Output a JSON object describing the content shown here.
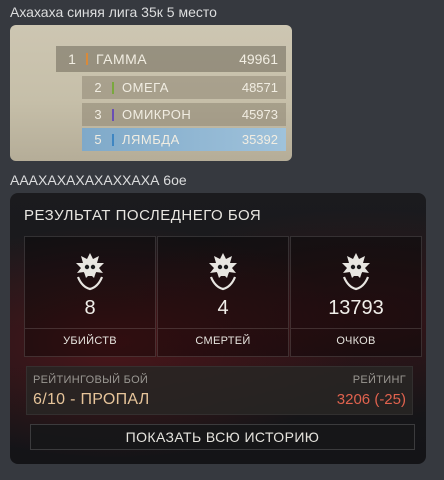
{
  "message1": {
    "text": "Ахахаха синяя лига 35к 5 место"
  },
  "leaderboard": {
    "top": {
      "rank": "1",
      "team": "ГАММА",
      "score": "49961",
      "color": "#d98a3a"
    },
    "rows": [
      {
        "rank": "2",
        "team": "ОМЕГА",
        "score": "48571",
        "color": "#7aa83e"
      },
      {
        "rank": "3",
        "team": "ОМИКРОН",
        "score": "45973",
        "color": "#6a4fb5"
      },
      {
        "rank": "5",
        "team": "ЛЯМБДА",
        "score": "35392",
        "color": "#3f86c2"
      }
    ]
  },
  "message2": {
    "text": "АААХАХАХАХАХХАХА 6ое"
  },
  "card": {
    "title": "РЕЗУЛЬТАТ ПОСЛЕДНЕГО БОЯ",
    "stats": [
      {
        "value": "8",
        "label": "УБИЙСТВ",
        "icon": "skull-wreath-icon"
      },
      {
        "value": "4",
        "label": "СМЕРТЕЙ",
        "icon": "skull-wreath-icon"
      },
      {
        "value": "13793",
        "label": "ОЧКОВ",
        "icon": "skull-wreath-icon"
      }
    ],
    "rating": {
      "left_label": "РЕЙТИНГОВЫЙ БОЙ",
      "left_value": "6/10 - ПРОПАЛ",
      "right_label": "РЕЙТИНГ",
      "right_value": "3206 (-25)",
      "right_value_color": "#e0624e"
    },
    "history_button": "ПОКАЗАТЬ ВСЮ ИСТОРИЮ"
  }
}
